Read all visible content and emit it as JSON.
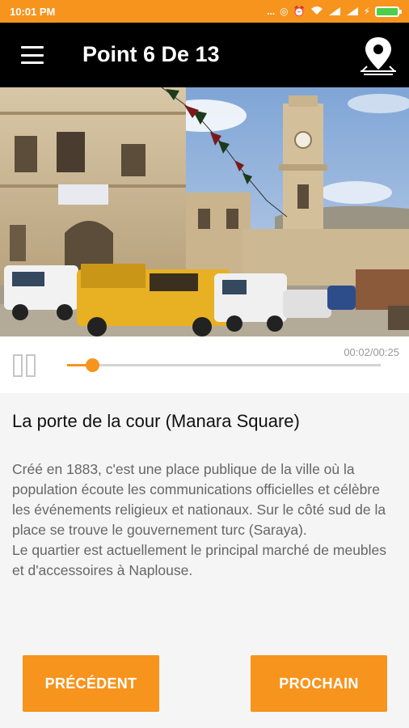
{
  "status_bar": {
    "time": "10:01 PM",
    "icons": [
      "dots-icon",
      "data-saver-icon",
      "alarm-icon",
      "wifi-icon",
      "signal-icon",
      "signal-icon",
      "charging-icon",
      "battery-icon"
    ],
    "more": "..."
  },
  "app_bar": {
    "title": "Point 6 De 13",
    "menu_icon": "menu-icon",
    "map_icon": "map-pin-icon"
  },
  "hero": {
    "image": "photo of Manara Square with clock tower, buildings and parked cars"
  },
  "player": {
    "time": "00:02/00:25",
    "progress": 0.08,
    "state_icon": "pause-icon"
  },
  "content": {
    "title": "La porte de la cour (Manara Square)",
    "description": "Créé en 1883, c'est une place publique de la ville où la population écoute les communications officielles et célèbre les événements religieux et nationaux. Sur le côté sud de la place se trouve le gouvernement turc (Saraya).\nLe quartier est actuellement le principal marché de meubles et d'accessoires à Naplouse."
  },
  "buttons": {
    "previous": "PRÉCÉDENT",
    "next": "PROCHAIN"
  },
  "colors": {
    "accent": "#f7941d",
    "app_bar": "#000000",
    "background": "#f5f5f5"
  }
}
